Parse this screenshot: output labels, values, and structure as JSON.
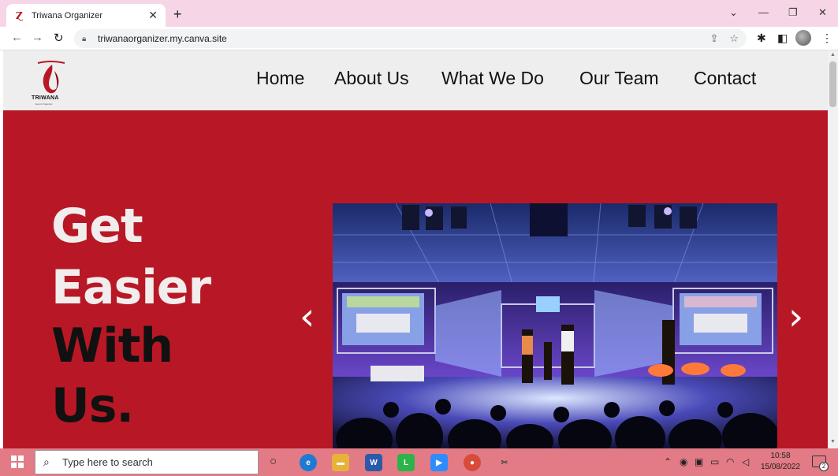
{
  "browser": {
    "tab_title": "Triwana Organizer",
    "tab_close": "✕",
    "new_tab": "+",
    "url": "triwanaorganizer.my.canva.site",
    "window_controls": {
      "minimize": "—",
      "restore": "❐",
      "close": "✕",
      "tabsearch": "⌄"
    }
  },
  "site": {
    "logo_text": "TRIWANA",
    "logo_sub": "Event Organizer",
    "nav": [
      "Home",
      "About Us",
      "What We Do",
      "Our Team",
      "Contact"
    ]
  },
  "hero": {
    "lines": [
      "Get",
      "Easier",
      "With",
      "Us."
    ],
    "prev": "‹",
    "next": "›",
    "accent_color": "#b81825"
  },
  "taskbar": {
    "search_placeholder": "Type here to search",
    "time": "10:58",
    "date": "15/08/2022",
    "notifications": "2"
  }
}
